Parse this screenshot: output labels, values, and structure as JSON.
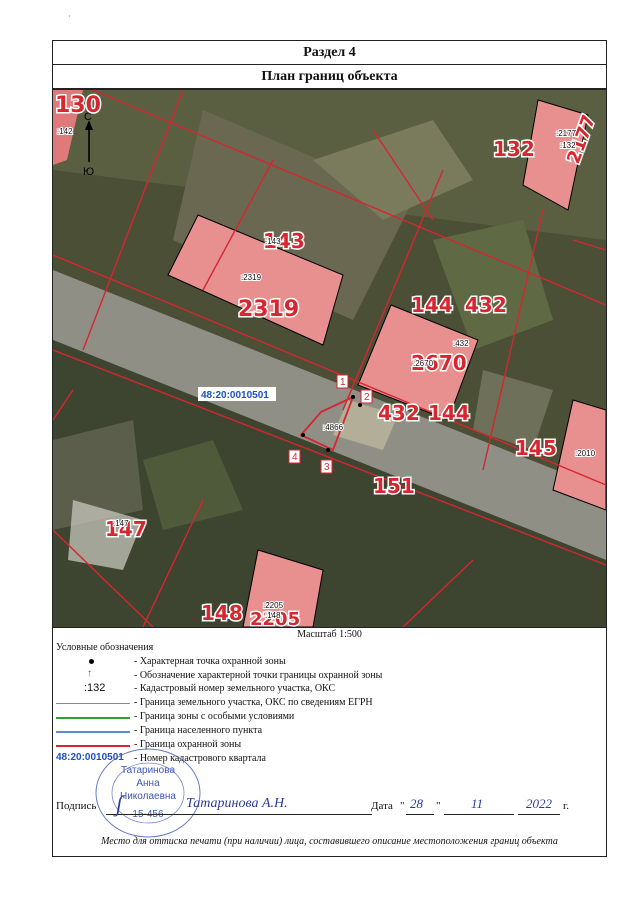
{
  "section_title": "Раздел 4",
  "plan_title": "План границ объекта",
  "speck": "·",
  "compass": {
    "north": "С",
    "south": "Ю"
  },
  "map": {
    "quarter_number": "48:20:0010501",
    "parcel_labels": [
      {
        "name": "parcel-label-130",
        "text": "130"
      },
      {
        "name": "parcel-label-143",
        "text": "143"
      },
      {
        "name": "parcel-label-2319",
        "text": "2319"
      },
      {
        "name": "parcel-label-132",
        "text": "132"
      },
      {
        "name": "parcel-label-2177-large",
        "text": "2177"
      },
      {
        "name": "parcel-label-144-top",
        "text": "144"
      },
      {
        "name": "parcel-label-432-top",
        "text": "432"
      },
      {
        "name": "parcel-label-2670",
        "text": "2670"
      },
      {
        "name": "parcel-label-432-bottom",
        "text": "432"
      },
      {
        "name": "parcel-label-144-bottom",
        "text": "144"
      },
      {
        "name": "parcel-label-145",
        "text": "145"
      },
      {
        "name": "parcel-label-151",
        "text": "151"
      },
      {
        "name": "parcel-label-147",
        "text": "147"
      },
      {
        "name": "parcel-label-148",
        "text": "148"
      },
      {
        "name": "parcel-label-2205",
        "text": "2205"
      }
    ],
    "cadastral_labels": [
      {
        "name": "cad-label-142",
        "text": ":142"
      },
      {
        "name": "cad-label-2177",
        "text": ":2177"
      },
      {
        "name": "cad-label-132",
        "text": ":132"
      },
      {
        "name": "cad-label-143",
        "text": ":143"
      },
      {
        "name": "cad-label-2319",
        "text": ":2319"
      },
      {
        "name": "cad-label-2670",
        "text": ":2670"
      },
      {
        "name": "cad-label-432",
        "text": ":432"
      },
      {
        "name": "cad-label-4866",
        "text": ":4866"
      },
      {
        "name": "cad-label-2010",
        "text": ":2010"
      },
      {
        "name": "cad-label-147",
        "text": ":147"
      },
      {
        "name": "cad-label-2205",
        "text": ":2205"
      },
      {
        "name": "cad-label-148",
        "text": ":148"
      }
    ],
    "points": [
      {
        "name": "point-label-1",
        "text": "1"
      },
      {
        "name": "point-label-2",
        "text": "2"
      },
      {
        "name": "point-label-3",
        "text": "3"
      },
      {
        "name": "point-label-4",
        "text": "4"
      }
    ]
  },
  "scale": "Масштаб 1:500",
  "legend": {
    "title": "Условные обозначения",
    "items": [
      {
        "symbol": "dot",
        "text": "- Характерная точка охранной зоны"
      },
      {
        "symbol": "arrow",
        "text": "- Обозначение характерной точки границы охранной зоны"
      },
      {
        "symbol": "label",
        "label": ":132",
        "text": "- Кадастровый номер земельного участка, ОКС"
      },
      {
        "symbol": "line",
        "color": "#8a8a8a",
        "text": "- Граница земельного участка, ОКС по сведениям ЕГРН"
      },
      {
        "symbol": "line",
        "color": "#2fa32f",
        "text": "- Граница зоны с особыми условиями"
      },
      {
        "symbol": "line",
        "color": "#5b8bd6",
        "text": "- Граница населенного пункта"
      },
      {
        "symbol": "line",
        "color": "#d6262f",
        "text": "- Граница охранной зоны"
      },
      {
        "symbol": "label-blue",
        "label": "48:20:0010501",
        "text": "- Номер кадастрового квартала"
      }
    ]
  },
  "signature": {
    "label": "Подпись",
    "handwritten": "Татаринова А.Н.",
    "date_label": "Дата",
    "day": "28",
    "month": "11",
    "year": "2022",
    "year_suffix": "г."
  },
  "stamp": {
    "line1": "Татаринова",
    "line2": "Анна",
    "line3": "Николаевна",
    "line4": "15-456"
  },
  "footer_note": "Место для оттиска печати (при наличии) лица, составившего описание местоположения границ объекта",
  "colors": {
    "zone_boundary": "#d6262f",
    "parcel_text": "#d6262f",
    "quarter_text": "#1f4fbf"
  }
}
